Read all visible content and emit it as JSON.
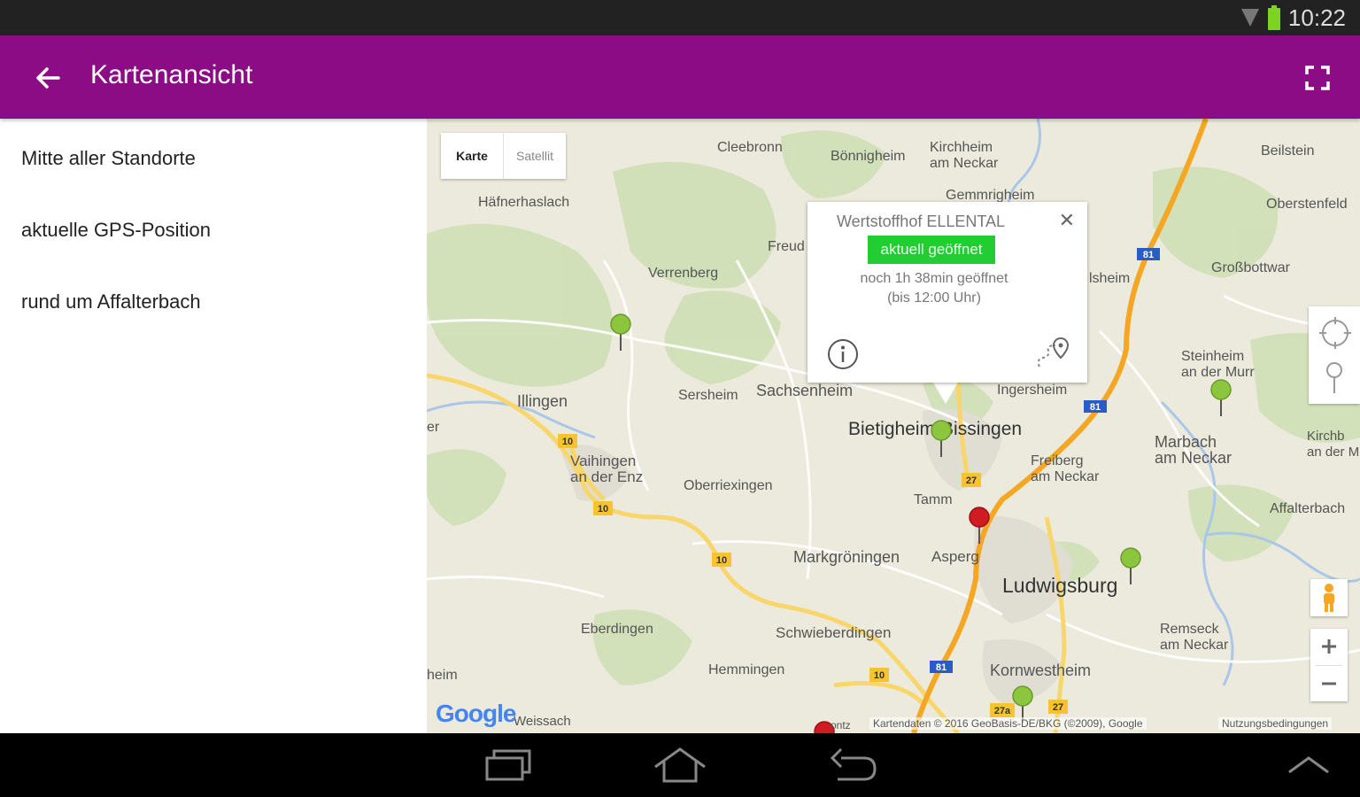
{
  "status_bar": {
    "time": "10:22"
  },
  "app_bar": {
    "title": "Kartenansicht"
  },
  "sidebar": {
    "items": [
      {
        "label": "Mitte aller Standorte"
      },
      {
        "label": "aktuelle GPS-Position"
      },
      {
        "label": "rund um Affalterbach"
      }
    ]
  },
  "map": {
    "type_toggle": {
      "map_label": "Karte",
      "satellite_label": "Satellit",
      "selected": "Karte"
    },
    "places": [
      "Cleebronn",
      "Bönnigheim",
      "Kirchheim\nam Neckar",
      "Beilstein",
      "Häfnerhaslach",
      "Gemmrigheim",
      "Oberstenfeld",
      "Freud",
      "Verrenberg",
      "lsheim",
      "Großbottwar",
      "Steinheim\nan der Murr",
      "Illingen",
      "Sersheim",
      "Sachsenheim",
      "Ingersheim",
      "Bietigheim-Bissingen",
      "Vaihingen\nan der Enz",
      "Freiberg\nam Neckar",
      "Marbach\nam Neckar",
      "Kirchb\nan der M",
      "Oberriexingen",
      "Tamm",
      "Affalterbach",
      "Markgröningen",
      "Asperg",
      "Ludwigsburg",
      "Eberdingen",
      "Schwieberdingen",
      "Remseck\nam Neckar",
      "Hemmingen",
      "Kornwestheim",
      "Weissach",
      "er",
      "heim"
    ],
    "road_labels": [
      "10",
      "10",
      "10",
      "10",
      "81",
      "81",
      "81",
      "27",
      "27",
      "27a"
    ],
    "popup": {
      "title": "Wertstoffhof ELLENTAL",
      "status": "aktuell geöffnet",
      "line1": "noch 1h 38min geöffnet",
      "line2": "(bis 12:00 Uhr)"
    },
    "attribution": "Kartendaten © 2016 GeoBasis-DE/BKG (©2009), Google",
    "terms": "Nutzungsbedingungen",
    "google_logo": "Google",
    "partial_label": "ontz",
    "colors": {
      "pin_green": "#8cc63f",
      "pin_red": "#d01b22",
      "highway": "#f5a623",
      "road": "#f8d66b",
      "water": "#aac6e8",
      "forest": "#cfe0b5"
    }
  },
  "colors": {
    "app_bar": "#8c0c86",
    "badge_green": "#22cc33"
  },
  "icons": [
    "arrow-back-icon",
    "fullscreen-icon",
    "wifi-icon",
    "battery-icon",
    "info-icon",
    "route-icon",
    "my-location-icon",
    "pin-icon",
    "pegman-icon",
    "zoom-in-icon",
    "zoom-out-icon",
    "recents-icon",
    "home-icon",
    "back-icon",
    "chevron-up-icon"
  ]
}
